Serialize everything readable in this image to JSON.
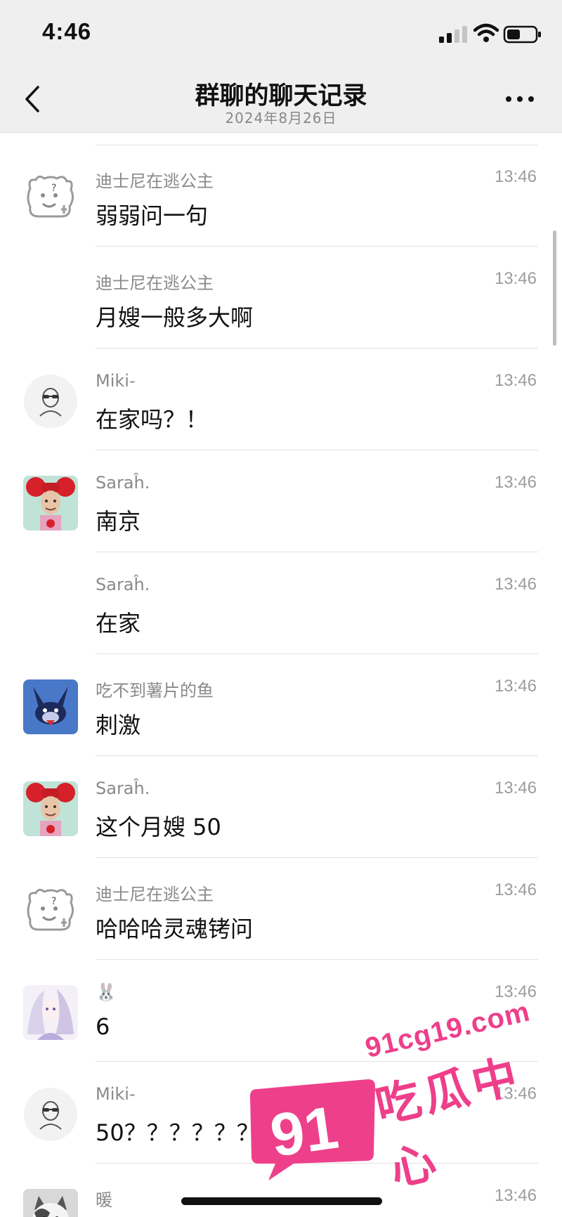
{
  "status_bar": {
    "time": "4:46"
  },
  "nav": {
    "title": "群聊的聊天记录",
    "subtitle": "2024年8月26日"
  },
  "messages": [
    {
      "name": "迪士尼在逃公主",
      "time": "13:46",
      "text": "弱弱问一句",
      "avatar": "bear-sketch"
    },
    {
      "name": "迪士尼在逃公主",
      "time": "13:46",
      "text": "月嫂一般多大啊",
      "avatar": ""
    },
    {
      "name": "Miki-",
      "time": "13:46",
      "text": "在家吗？！",
      "avatar": "sunglasses-sketch"
    },
    {
      "name": "Saraĥ.",
      "time": "13:46",
      "text": "南京",
      "avatar": "red-hair-character"
    },
    {
      "name": "Saraĥ.",
      "time": "13:46",
      "text": "在家",
      "avatar": ""
    },
    {
      "name": "吃不到薯片的鱼",
      "time": "13:46",
      "text": "刺激",
      "avatar": "cartoon-rabbit"
    },
    {
      "name": "Saraĥ.",
      "time": "13:46",
      "text": "这个月嫂 50",
      "avatar": "red-hair-character"
    },
    {
      "name": "迪士尼在逃公主",
      "time": "13:46",
      "text": "哈哈哈灵魂铐问",
      "avatar": "bear-sketch"
    },
    {
      "name": "🐰",
      "time": "13:46",
      "text": "6",
      "avatar": "anime-illustration"
    },
    {
      "name": "Miki-",
      "time": "13:46",
      "text": "50？？？？？？？？？",
      "avatar": "sunglasses-sketch"
    },
    {
      "name": "暖",
      "time": "13:46",
      "text": "",
      "avatar": "cat-photo"
    }
  ],
  "watermark": {
    "number": "91",
    "url": "91cg19.com",
    "brand": "吃瓜中心"
  },
  "colors": {
    "accent": "#ee3f8a",
    "bar": "#efefef",
    "divider": "#e2e2e2"
  }
}
